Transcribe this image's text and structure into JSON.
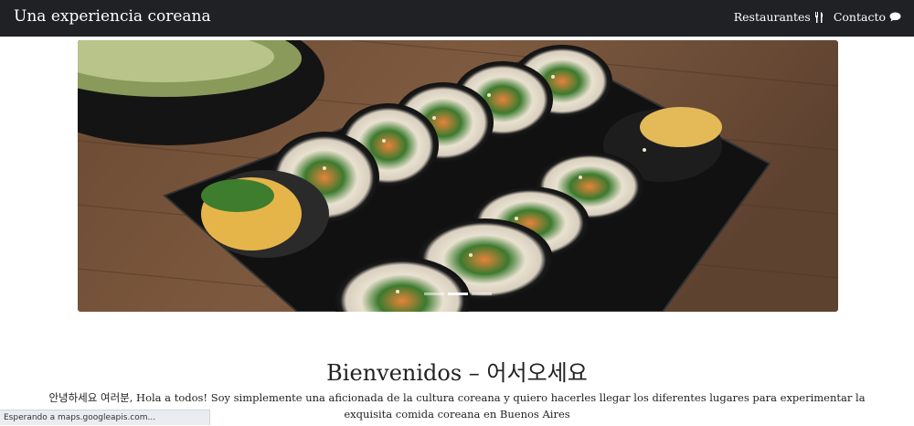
{
  "navbar": {
    "brand": "Una experiencia coreana",
    "links": [
      {
        "label": "Restaurantes",
        "icon": "utensils-icon"
      },
      {
        "label": "Contacto",
        "icon": "speech-bubble-icon"
      }
    ],
    "background": "#1f2125"
  },
  "carousel": {
    "image": "kimbap-photo",
    "slide_count": 3,
    "active_slide": 1
  },
  "main": {
    "title": "Bienvenidos – 어서오세요",
    "intro": "안녕하세요 여러분, Hola a todos! Soy simplemente una aficionada de la cultura coreana y quiero hacerles llegar los diferentes lugares para experimentar la exquisita comida coreana en Buenos Aires"
  },
  "status_bar": {
    "text": "Esperando a maps.googleapis.com..."
  }
}
